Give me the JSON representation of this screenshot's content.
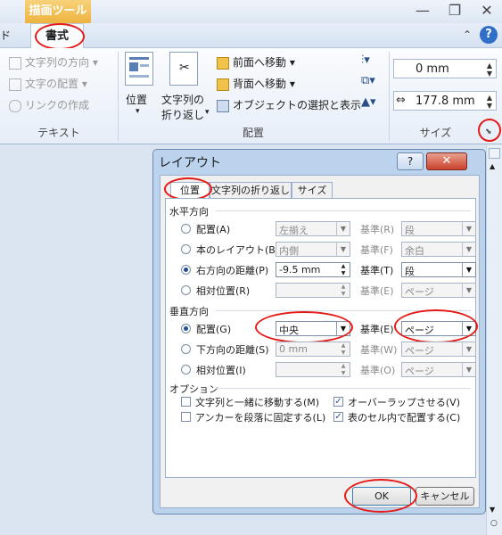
{
  "ribbon": {
    "contextual_tab": "描画ツール",
    "prev_tab_fragment": "ド",
    "active_tab": "書式",
    "text_group": {
      "label": "テキスト",
      "items": [
        "文字列の方向",
        "文字の配置",
        "リンクの作成"
      ]
    },
    "arrange_group": {
      "label": "配置",
      "position": "位置",
      "wrap_line1": "文字列の",
      "wrap_line2": "折り返し",
      "bring_forward": "前面へ移動",
      "send_backward": "背面へ移動",
      "selection_pane": "オブジェクトの選択と表示"
    },
    "size_group": {
      "label": "サイズ",
      "height": "0 mm",
      "width": "177.8 mm"
    }
  },
  "dialog": {
    "title": "レイアウト",
    "help": "?",
    "close": "✕",
    "tabs": [
      "位置",
      "文字列の折り返し",
      "サイズ"
    ],
    "horizontal": {
      "header": "水平方向",
      "rows": [
        {
          "label": "配置(A)",
          "value": "左揃え",
          "base_label": "基準(R)",
          "base": "段"
        },
        {
          "label": "本のレイアウト(B)",
          "value": "内側",
          "base_label": "基準(F)",
          "base": "余白"
        },
        {
          "label": "右方向の距離(P)",
          "value": "-9.5 mm",
          "base_label": "基準(T)",
          "base": "段"
        },
        {
          "label": "相対位置(R)",
          "value": "",
          "base_label": "基準(E)",
          "base": "ページ"
        }
      ]
    },
    "vertical": {
      "header": "垂直方向",
      "rows": [
        {
          "label": "配置(G)",
          "value": "中央",
          "base_label": "基準(E)",
          "base": "ページ"
        },
        {
          "label": "下方向の距離(S)",
          "value": "0 mm",
          "base_label": "基準(W)",
          "base": "ページ"
        },
        {
          "label": "相対位置(I)",
          "value": "",
          "base_label": "基準(O)",
          "base": "ページ"
        }
      ]
    },
    "options": {
      "header": "オプション",
      "move_with_text": "文字列と一緒に移動する(M)",
      "lock_anchor": "アンカーを段落に固定する(L)",
      "allow_overlap": "オーバーラップさせる(V)",
      "layout_in_cell": "表のセル内で配置する(C)"
    },
    "ok": "OK",
    "cancel": "キャンセル"
  },
  "colors": {
    "highlight": "#e41b17",
    "contextual": "#eeb33f"
  }
}
